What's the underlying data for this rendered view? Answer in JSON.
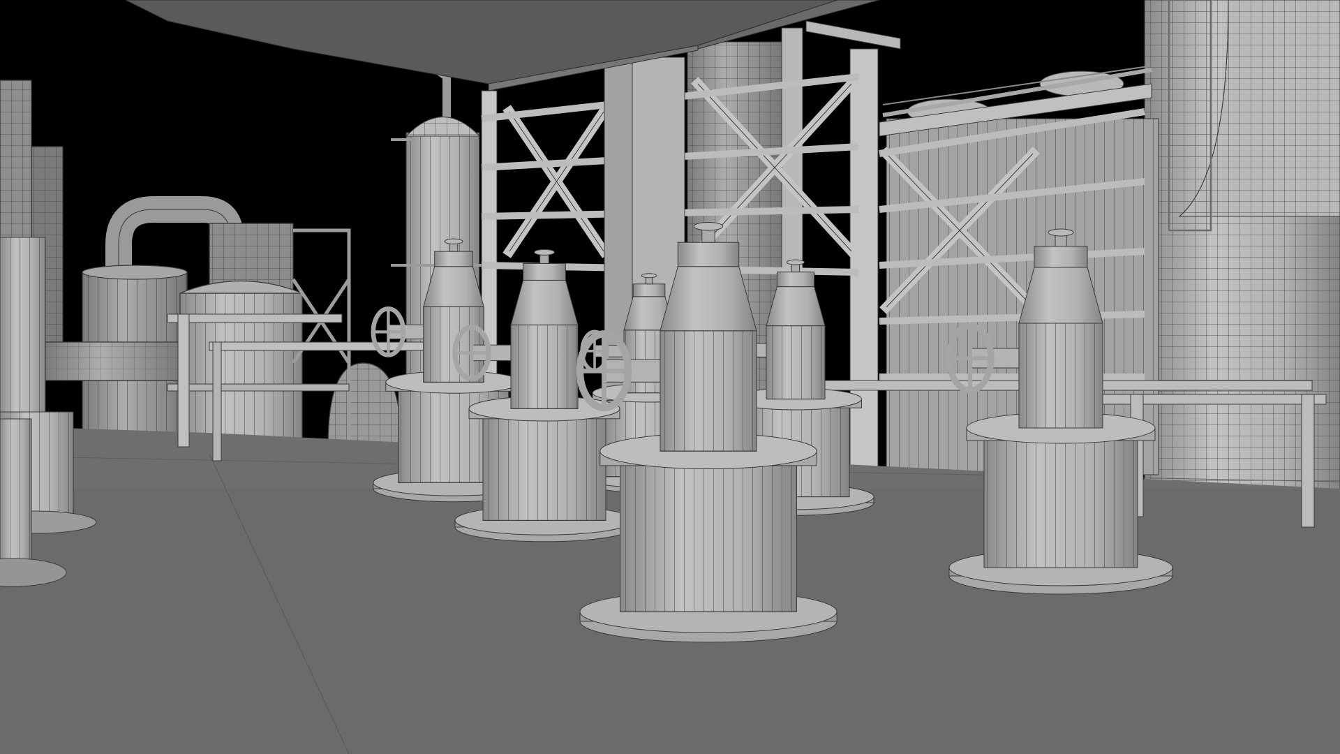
{
  "scene": {
    "colors": {
      "sky": "#000000",
      "floor": "#6b6b6b",
      "floor_far": "#727272",
      "ceiling": "#5e5e5e",
      "metal_light": "#b9b9b9",
      "metal_mid": "#9e9e9e",
      "metal_dark": "#7d7d7d",
      "wire": "#3a3a3a"
    },
    "objects": {
      "valves": 7,
      "handwheels": 5,
      "towers": 4,
      "structural_frames": 2
    }
  }
}
